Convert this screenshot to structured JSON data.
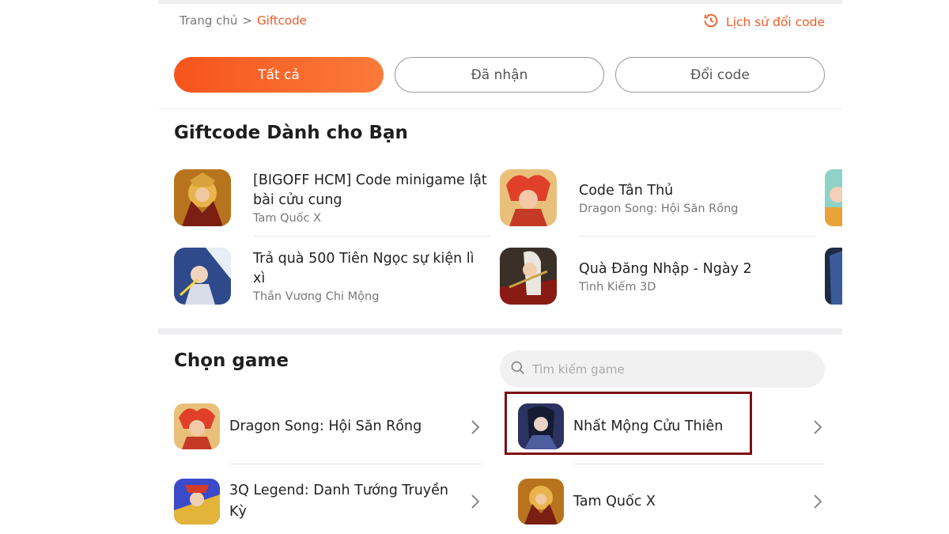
{
  "breadcrumb": {
    "home": "Trang chủ",
    "separator": ">",
    "current": "Giftcode"
  },
  "history_link": {
    "label": "Lịch sử đổi code",
    "icon": "history-clock-icon"
  },
  "tabs": [
    {
      "label": "Tất cả",
      "active": true
    },
    {
      "label": "Đã nhận",
      "active": false
    },
    {
      "label": "Đổi code",
      "active": false
    }
  ],
  "giftcodes": {
    "title": "Giftcode Dành cho Bạn",
    "items": [
      {
        "title": "[BIGOFF HCM] Code minigame lật bài cửu cung",
        "game": "Tam Quốc X"
      },
      {
        "title": "Code Tân Thủ",
        "game": "Dragon Song: Hội Săn Rồng"
      },
      {
        "title": "Trả quà 500 Tiên Ngọc sự kiện lì xì",
        "game": "Thần Vương Chi Mộng"
      },
      {
        "title": "Quà Đăng Nhập - Ngày 2",
        "game": "Tình Kiếm 3D"
      }
    ]
  },
  "choose_game": {
    "title": "Chọn game",
    "search_placeholder": "Tìm kiếm game",
    "games": [
      {
        "name": "Dragon Song: Hội Săn Rồng"
      },
      {
        "name": "Nhất Mộng Cửu Thiên",
        "highlighted": true
      },
      {
        "name": "3Q Legend: Danh Tướng Truyền Kỳ"
      },
      {
        "name": "Tam Quốc X"
      }
    ]
  },
  "colors": {
    "accent": "#f05a28",
    "highlight_border": "#7d0f12"
  }
}
